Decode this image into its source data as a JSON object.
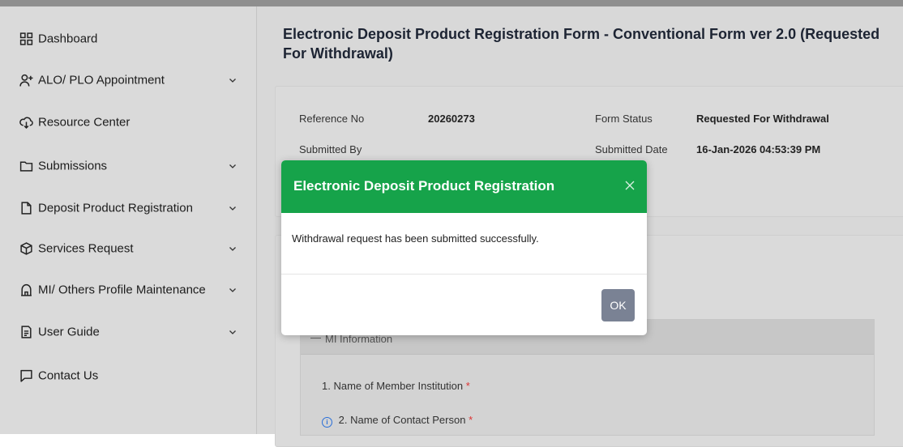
{
  "sidebar": {
    "items": [
      {
        "label": "Dashboard",
        "icon": "dashboard-grid-icon",
        "has_chevron": false
      },
      {
        "label": "ALO/ PLO Appointment",
        "icon": "user-add-icon",
        "has_chevron": true
      },
      {
        "label": "Resource Center",
        "icon": "download-icon",
        "has_chevron": false
      },
      {
        "label": "Submissions",
        "icon": "folder-icon",
        "has_chevron": true
      },
      {
        "label": "Deposit Product Registration",
        "icon": "document-icon",
        "has_chevron": true
      },
      {
        "label": "Services Request",
        "icon": "cube-icon",
        "has_chevron": true
      },
      {
        "label": "MI/ Others Profile Maintenance",
        "icon": "bank-icon",
        "has_chevron": true
      },
      {
        "label": "User Guide",
        "icon": "guide-icon",
        "has_chevron": true
      },
      {
        "label": "Contact Us",
        "icon": "chat-icon",
        "has_chevron": false
      }
    ]
  },
  "page": {
    "title": "Electronic Deposit Product Registration Form - Conventional Form ver 2.0 (Requested For Withdrawal)"
  },
  "info": {
    "reference_no_label": "Reference No",
    "reference_no_value": "20260273",
    "form_status_label": "Form Status",
    "form_status_value": "Requested For Withdrawal",
    "submitted_by_label": "Submitted By",
    "submitted_by_value": "",
    "submitted_date_label": "Submitted Date",
    "submitted_date_value": "16-Jan-2026 04:53:39 PM"
  },
  "mi_section": {
    "header": "MI Information",
    "fields": [
      {
        "label": "1. Name of Member Institution",
        "required": "*"
      },
      {
        "label": "2. Name of Contact Person",
        "required": "*"
      }
    ]
  },
  "modal": {
    "title": "Electronic Deposit Product Registration",
    "message": "Withdrawal request has been submitted successfully.",
    "ok_label": "OK",
    "header_color": "#16a34a"
  },
  "colors": {
    "sidebar_bg": "#dadada",
    "ok_button": "#7a8294"
  }
}
